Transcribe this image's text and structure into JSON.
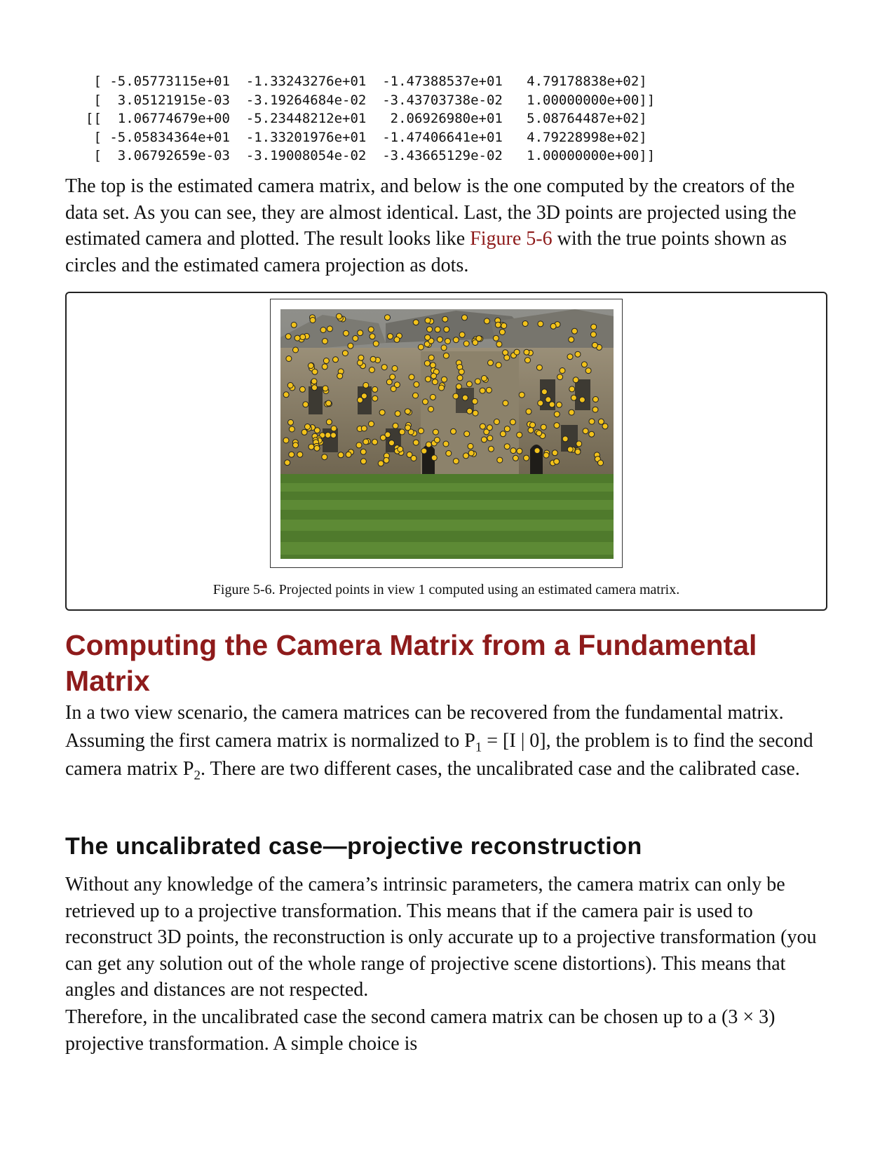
{
  "matrix_rows": [
    " [ -5.05773115e+01  -1.33243276e+01  -1.47388537e+01   4.79178838e+02]",
    " [  3.05121915e-03  -3.19264684e-02  -3.43703738e-02   1.00000000e+00]]",
    "[[  1.06774679e+00  -5.23448212e+01   2.06926980e+01   5.08764487e+02]",
    " [ -5.05834364e+01  -1.33201976e+01  -1.47406641e+01   4.79228998e+02]",
    " [  3.06792659e-03  -3.19008054e-02  -3.43665129e-02   1.00000000e+00]]"
  ],
  "para1": {
    "before_link": "The top is the estimated camera matrix, and below is the one computed by the creators of the data set. As you can see, they are almost identical. Last, the 3D points are projected using the estimated camera and plotted. The result looks like ",
    "link": "Figure 5-6",
    "after_link": " with the true points shown as circles and the estimated camera projection as dots."
  },
  "figure": {
    "caption": "Figure 5-6. Projected points in view 1 computed using an estimated camera matrix."
  },
  "section_heading": "Computing the Camera Matrix from a Fundamental Matrix",
  "para2": {
    "part1": "In a two view scenario, the camera matrices can be recovered from the fundamental matrix. Assuming the first camera matrix is normalized to P",
    "sub1": "1",
    "part2": " = [I | 0], the problem is to find the second camera matrix P",
    "sub2": "2",
    "part3": ". There are two different cases, the uncalibrated case and the calibrated case."
  },
  "subsection_heading": "The uncalibrated case—projective reconstruction",
  "para3": "Without any knowledge of the camera’s intrinsic parameters, the camera matrix can only be retrieved up to a projective transformation. This means that if the camera pair is used to reconstruct 3D points, the reconstruction is only accurate up to a projective transformation (you can get any solution out of the whole range of projective scene distortions). This means that angles and distances are not respected.",
  "para4": "Therefore, in the uncalibrated case the second camera matrix can be chosen up to a (3 × 3) projective transformation. A simple choice is",
  "colors": {
    "heading": "#8e1b1b",
    "link": "#8e1b1b",
    "point_fill": "#f2c21b"
  }
}
